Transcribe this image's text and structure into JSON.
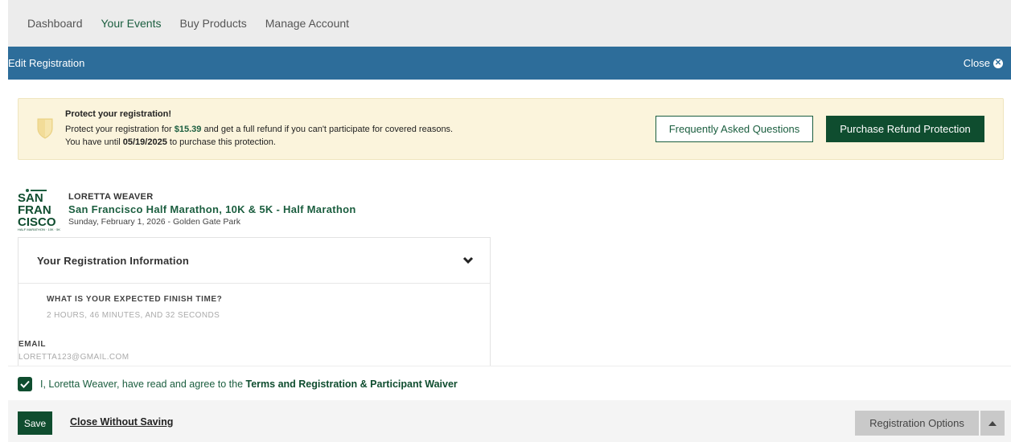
{
  "nav": {
    "items": [
      {
        "label": "Dashboard"
      },
      {
        "label": "Your Events"
      },
      {
        "label": "Buy Products"
      },
      {
        "label": "Manage Account"
      }
    ],
    "active": "Your Events"
  },
  "edit_bar": {
    "title": "Edit Registration",
    "close_label": "Close",
    "close_icon": "close-circle-icon"
  },
  "protection": {
    "title": "Protect your registration!",
    "line1_pre": "Protect your registration for ",
    "price": "$15.39",
    "line1_post": " and get a full refund if you can't participate for covered reasons.",
    "line2_pre": "You have until ",
    "deadline": "05/19/2025",
    "line2_post": " to purchase this protection.",
    "icon": "shield-icon",
    "faq_label": "Frequently Asked Questions",
    "purchase_label": "Purchase Refund Protection"
  },
  "event": {
    "logo_lines": [
      "SAN",
      "FRAN",
      "CISCO"
    ],
    "logo_sub": "HALF MARATHON · 10K · 5K",
    "participant": "LORETTA WEAVER",
    "name": "San Francisco Half Marathon, 10K & 5K - Half Marathon",
    "date_location": "Sunday, February 1, 2026 - Golden Gate Park"
  },
  "registration": {
    "header": "Your Registration Information",
    "fields": [
      {
        "label": "WHAT IS YOUR EXPECTED FINISH TIME?",
        "value": "2 HOURS, 46 MINUTES, AND 32 SECONDS"
      },
      {
        "label": "EMAIL",
        "value": "LORETTA123@GMAIL.COM"
      }
    ]
  },
  "agreement": {
    "checked": true,
    "text_pre": "I, Loretta Weaver, have read and agree to the ",
    "link": "Terms and Registration & Participant Waiver"
  },
  "footer": {
    "save_label": "Save",
    "close_without_saving": "Close Without Saving",
    "registration_options": "Registration Options"
  },
  "colors": {
    "brand_green": "#0f4d2f",
    "header_blue": "#2d6d9a",
    "banner_yellow": "#fbf4dc"
  }
}
